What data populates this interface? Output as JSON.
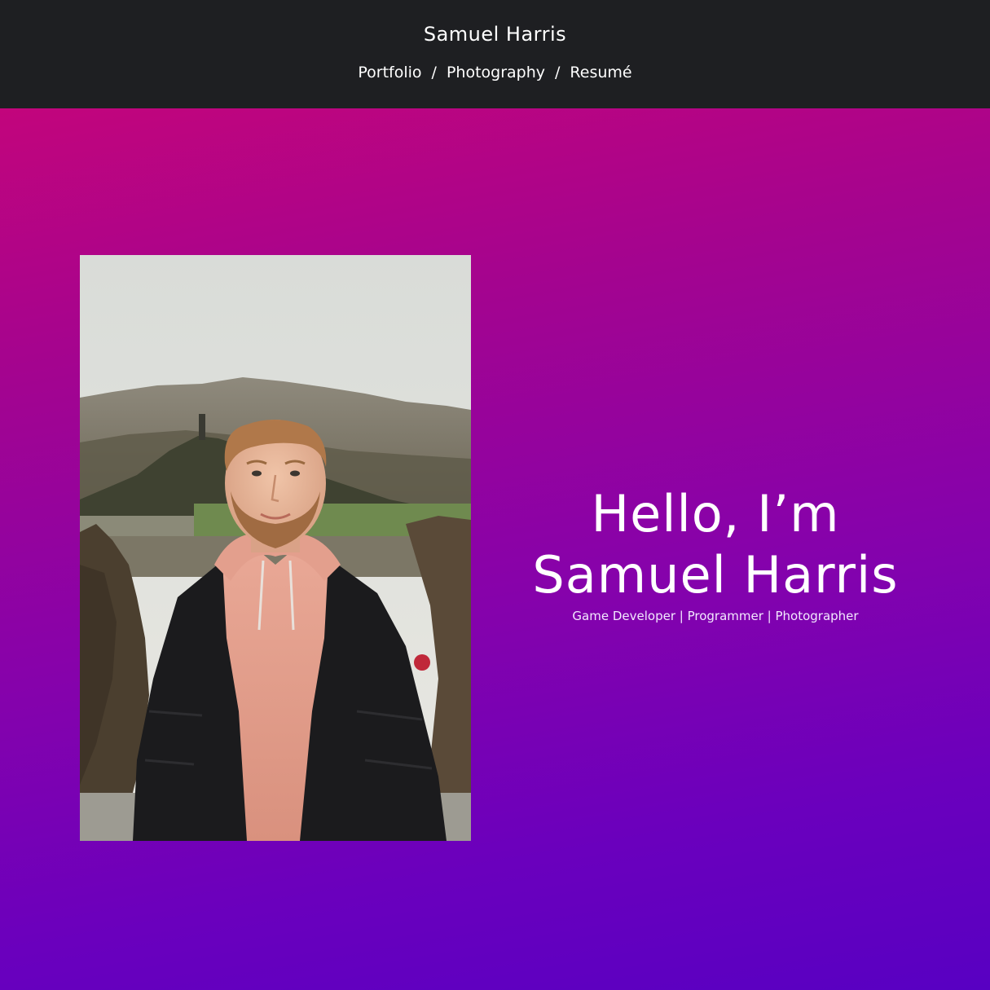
{
  "header": {
    "site_title": "Samuel Harris",
    "nav": {
      "items": [
        {
          "label": "Portfolio"
        },
        {
          "label": "Photography"
        },
        {
          "label": "Resumé"
        }
      ],
      "separator": "/"
    }
  },
  "hero": {
    "greeting": "Hello, I’m Samuel Harris",
    "tagline": "Game Developer | Programmer | Photographer"
  },
  "colors": {
    "header_bg": "#1e1f22",
    "gradient_top": "#c2057c",
    "gradient_bottom": "#5800c2",
    "text": "#ffffff"
  }
}
